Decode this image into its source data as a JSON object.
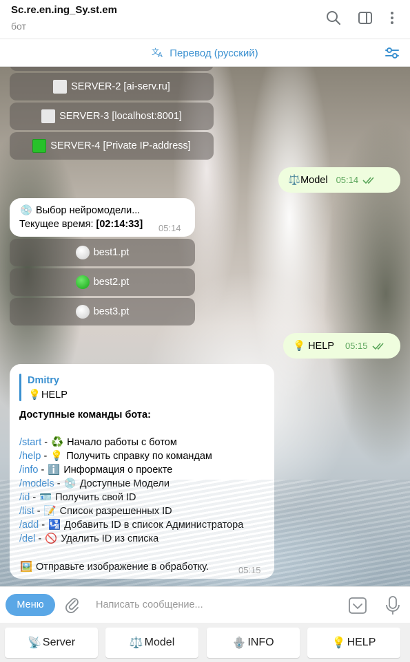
{
  "header": {
    "title": "Sc.re.en.ing_Sy.st.em",
    "subtitle": "бот"
  },
  "translate_bar": {
    "label": "Перевод (русский)"
  },
  "chat": {
    "server_buttons": [
      {
        "label": "SERVER-2 [ai-serv.ru]",
        "status": "gray"
      },
      {
        "label": "SERVER-3 [localhost:8001]",
        "status": "gray"
      },
      {
        "label": "SERVER-4 [Private IP-address]",
        "status": "green"
      }
    ],
    "out_model": {
      "text": "Model",
      "icon": "⚖️",
      "time": "05:14"
    },
    "model_select": {
      "line1": "Выбор нейромодели...",
      "line2_prefix": "Текущее время: ",
      "line2_value": "[02:14:33]",
      "time": "05:14"
    },
    "model_buttons": [
      {
        "label": "best1.pt",
        "status": "white"
      },
      {
        "label": "best2.pt",
        "status": "green"
      },
      {
        "label": "best3.pt",
        "status": "white"
      }
    ],
    "out_help": {
      "text": "HELP",
      "icon": "💡",
      "time": "05:15"
    },
    "help_message": {
      "reply_author": "Dmitry",
      "reply_text": "HELP",
      "heading": "Доступные команды бота:",
      "commands": [
        {
          "cmd": "/start",
          "sep": " - ",
          "emoji": "♻️",
          "text": "Начало работы с ботом"
        },
        {
          "cmd": "/help",
          "sep": " - ",
          "emoji": "💡",
          "text": "Получить справку по командам"
        },
        {
          "cmd": "/info",
          "sep": " - ",
          "emoji": "ℹ️",
          "text": "Информация о проекте"
        },
        {
          "cmd": "/models",
          "sep": " - ",
          "emoji": "💿",
          "text": "Доступные Модели"
        },
        {
          "cmd": "/id",
          "sep": " - ",
          "emoji": "🪪",
          "text": "Получить свой ID"
        },
        {
          "cmd": "/list",
          "sep": " - ",
          "emoji": "📝",
          "text": "Список разрешенных ID"
        },
        {
          "cmd": "/add",
          "sep": " - ",
          "emoji": "🛂",
          "text": "Добавить ID в список Администратора"
        },
        {
          "cmd": "/del",
          "sep": " - ",
          "emoji": "🚫",
          "text": "Удалить ID из списка"
        }
      ],
      "footer": "Отправьте изображение в обработку.",
      "time": "05:15"
    }
  },
  "input_bar": {
    "menu_label": "Меню",
    "placeholder": "Написать сообщение..."
  },
  "reply_keyboard": [
    {
      "icon": "📡",
      "label": "Server"
    },
    {
      "icon": "⚖️",
      "label": "Model"
    },
    {
      "icon": "🪬",
      "label": "INFO"
    },
    {
      "icon": "💡",
      "label": "HELP"
    }
  ],
  "colors": {
    "accent": "#3a90d0",
    "menu_button": "#5aa7e6",
    "outgoing_bubble": "#effdde",
    "outgoing_time": "#5aa55a"
  }
}
